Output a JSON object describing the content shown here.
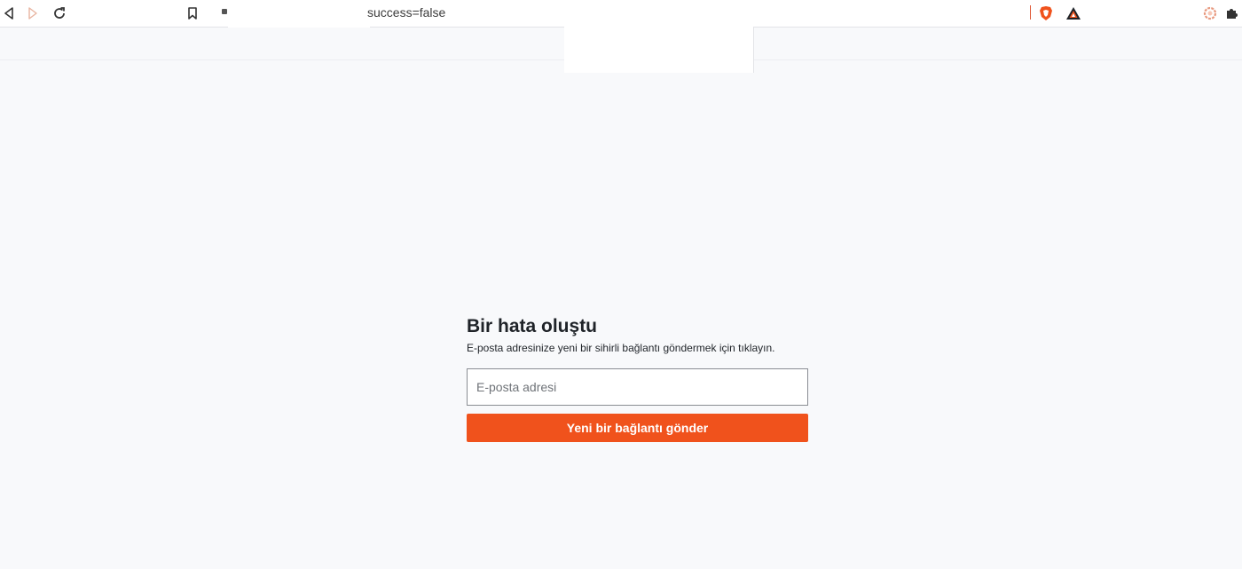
{
  "browser": {
    "url_suffix": "success=false",
    "icons": {
      "back": "back-icon",
      "forward": "forward-icon",
      "reload": "reload-icon",
      "bookmark": "bookmark-icon",
      "brave_shield": "brave-shield-icon",
      "brave_rewards": "brave-rewards-icon",
      "vpn": "vpn-icon",
      "extensions": "extensions-icon"
    }
  },
  "form": {
    "title": "Bir hata oluştu",
    "subtitle": "E-posta adresinize yeni bir sihirli bağlantı göndermek için tıklayın.",
    "email_placeholder": "E-posta adresi",
    "email_value": "",
    "submit_label": "Yeni bir bağlantı gönder"
  },
  "colors": {
    "accent": "#f0521c",
    "page_bg": "#f8f9fb",
    "text": "#1f2328"
  }
}
